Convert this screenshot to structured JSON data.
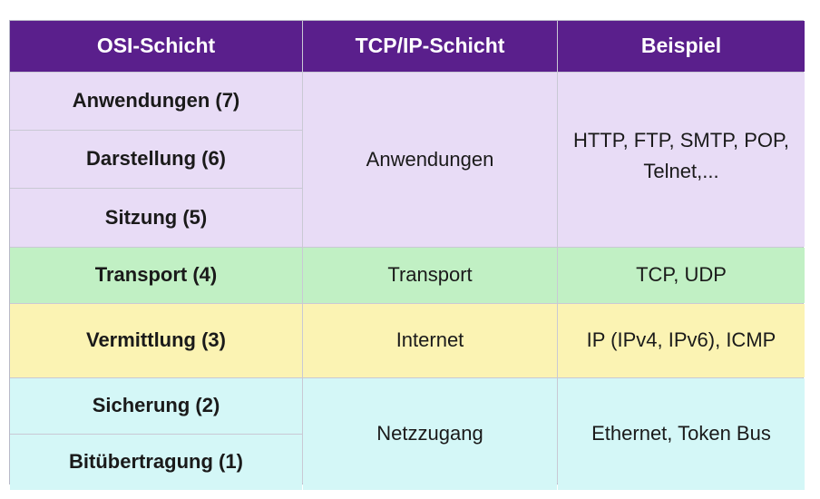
{
  "headers": {
    "osi": "OSI-Schicht",
    "tcpip": "TCP/IP-Schicht",
    "example": "Beispiel"
  },
  "osi_layers": [
    "Anwendungen (7)",
    "Darstellung (6)",
    "Sitzung (5)",
    "Transport (4)",
    "Vermittlung (3)",
    "Sicherung (2)",
    "Bitübertragung (1)"
  ],
  "tcpip_layers": {
    "application": "Anwendungen",
    "transport": "Transport",
    "internet": "Internet",
    "network_access": "Netzzugang"
  },
  "examples": {
    "application": "HTTP, FTP, SMTP, POP,\nTelnet,...",
    "transport": "TCP, UDP",
    "internet": "IP (IPv4, IPv6), ICMP",
    "network_access": "Ethernet, Token Bus"
  },
  "colors": {
    "header": "#5a1f8c",
    "application": "#e8dcf6",
    "transport": "#c1f0c4",
    "internet": "#fbf3b3",
    "network_access": "#d4f7f7"
  }
}
